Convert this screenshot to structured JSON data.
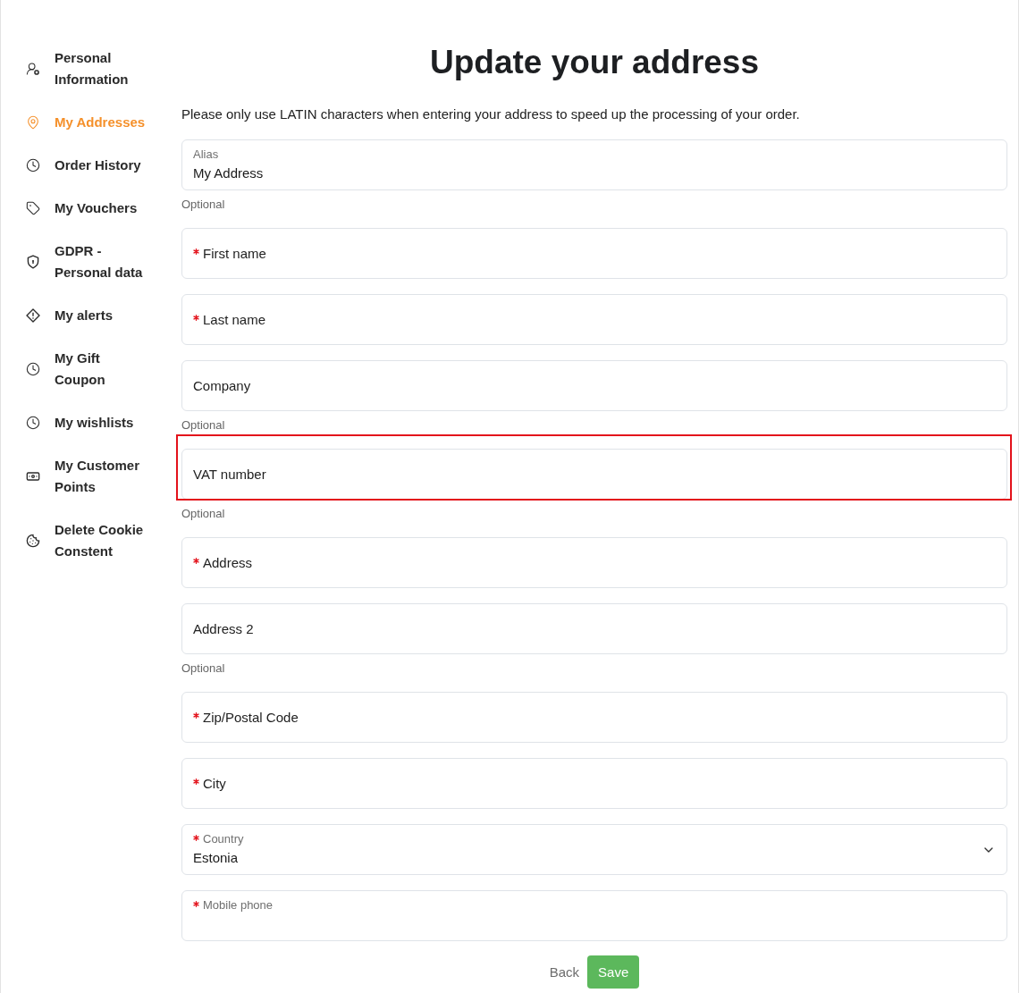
{
  "sidebar": {
    "items": [
      {
        "label": "Personal Information",
        "selected": false
      },
      {
        "label": "My Addresses",
        "selected": true
      },
      {
        "label": "Order History",
        "selected": false
      },
      {
        "label": "My Vouchers",
        "selected": false
      },
      {
        "label": "GDPR - Personal data",
        "selected": false
      },
      {
        "label": "My alerts",
        "selected": false
      },
      {
        "label": "My Gift Coupon",
        "selected": false
      },
      {
        "label": "My wishlists",
        "selected": false
      },
      {
        "label": "My Customer Points",
        "selected": false
      },
      {
        "label": "Delete Cookie Constent",
        "selected": false
      }
    ]
  },
  "page": {
    "title": "Update your address",
    "notice": "Please only use LATIN characters when entering your address to speed up the processing of your order."
  },
  "form": {
    "fields": [
      {
        "kind": "floating",
        "label": "Alias",
        "required": false,
        "value": "My Address",
        "hint": "Optional",
        "highlighted": false
      },
      {
        "kind": "inline",
        "label": "First name",
        "required": true,
        "highlighted": false
      },
      {
        "kind": "inline",
        "label": "Last name",
        "required": true,
        "highlighted": false
      },
      {
        "kind": "inline",
        "label": "Company",
        "required": false,
        "hint": "Optional",
        "highlighted": false
      },
      {
        "kind": "inline",
        "label": "VAT number",
        "required": false,
        "hint": "Optional",
        "highlighted": true
      },
      {
        "kind": "inline",
        "label": "Address",
        "required": true,
        "highlighted": false
      },
      {
        "kind": "inline",
        "label": "Address 2",
        "required": false,
        "hint": "Optional",
        "highlighted": false
      },
      {
        "kind": "inline",
        "label": "Zip/Postal Code",
        "required": true,
        "highlighted": false
      },
      {
        "kind": "inline",
        "label": "City",
        "required": true,
        "highlighted": false
      },
      {
        "kind": "select",
        "label": "Country",
        "required": true,
        "value": "Estonia",
        "highlighted": false
      },
      {
        "kind": "floating",
        "label": "Mobile phone",
        "required": true,
        "highlighted": false
      }
    ]
  },
  "actions": {
    "back": "Back",
    "save": "Save"
  }
}
